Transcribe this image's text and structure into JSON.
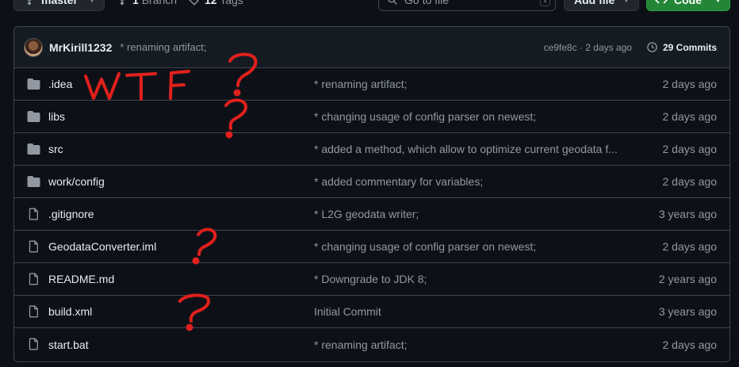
{
  "toolbar": {
    "branch": "master",
    "branches_count": "1",
    "branches_label": "Branch",
    "tags_count": "12",
    "tags_label": "Tags",
    "search_placeholder": "Go to file",
    "search_shortcut": "t",
    "add_file_label": "Add file",
    "code_label": "Code"
  },
  "latest_commit": {
    "author": "MrKirill1232",
    "message": "* renaming artifact;",
    "sha_date": "ce9fe8c · 2 days ago",
    "commits_count": "29 Commits"
  },
  "files": [
    {
      "type": "folder",
      "name": ".idea",
      "message": "* renaming artifact;",
      "date": "2 days ago"
    },
    {
      "type": "folder",
      "name": "libs",
      "message": "* changing usage of config parser on newest;",
      "date": "2 days ago"
    },
    {
      "type": "folder",
      "name": "src",
      "message": "* added a method, which allow to optimize current geodata f...",
      "date": "2 days ago"
    },
    {
      "type": "folder",
      "name": "work/config",
      "message": "* added commentary for variables;",
      "date": "2 days ago"
    },
    {
      "type": "file",
      "name": ".gitignore",
      "message": "* L2G geodata writer;",
      "date": "3 years ago"
    },
    {
      "type": "file",
      "name": "GeodataConverter.iml",
      "message": "* changing usage of config parser on newest;",
      "date": "2 days ago"
    },
    {
      "type": "file",
      "name": "README.md",
      "message": "* Downgrade to JDK 8;",
      "date": "2 years ago"
    },
    {
      "type": "file",
      "name": "build.xml",
      "message": "Initial Commit",
      "date": "3 years ago"
    },
    {
      "type": "file",
      "name": "start.bat",
      "message": "* renaming artifact;",
      "date": "2 days ago"
    }
  ],
  "annotations": {
    "handwritten_text": "WTF",
    "marks": [
      "?",
      "?",
      "?",
      "?"
    ],
    "color": "#e0201c"
  },
  "colors": {
    "background": "#0d1117",
    "header": "#151b23",
    "border": "#3d444d",
    "muted_text": "#9198a1",
    "code_button": "#238636"
  }
}
